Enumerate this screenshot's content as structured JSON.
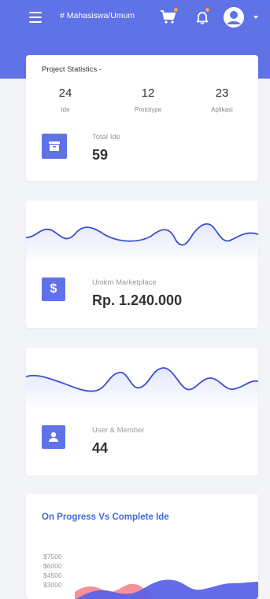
{
  "topbar": {
    "workspace": "# Mahasiswa/Umum",
    "colors": {
      "primary": "#5f72e6",
      "badge": "#f5a14a"
    }
  },
  "stats_card": {
    "title": "Project Statistics -",
    "stats": [
      {
        "value": "24",
        "label": "Ide"
      },
      {
        "value": "12",
        "label": "Prototype"
      },
      {
        "value": "23",
        "label": "Aplikasi"
      }
    ],
    "metric_label": "Total Ide",
    "metric_value": "59"
  },
  "marketplace_card": {
    "label": "Umkm Marketplace",
    "value": "Rp. 1.240.000",
    "icon": "dollar-icon"
  },
  "member_card": {
    "label": "User & Member",
    "value": "44",
    "icon": "user-icon"
  },
  "progress_card": {
    "title": "On Progress Vs Complete Ide",
    "y_ticks": [
      "$7500",
      "$6000",
      "$4500",
      "$3000"
    ]
  }
}
